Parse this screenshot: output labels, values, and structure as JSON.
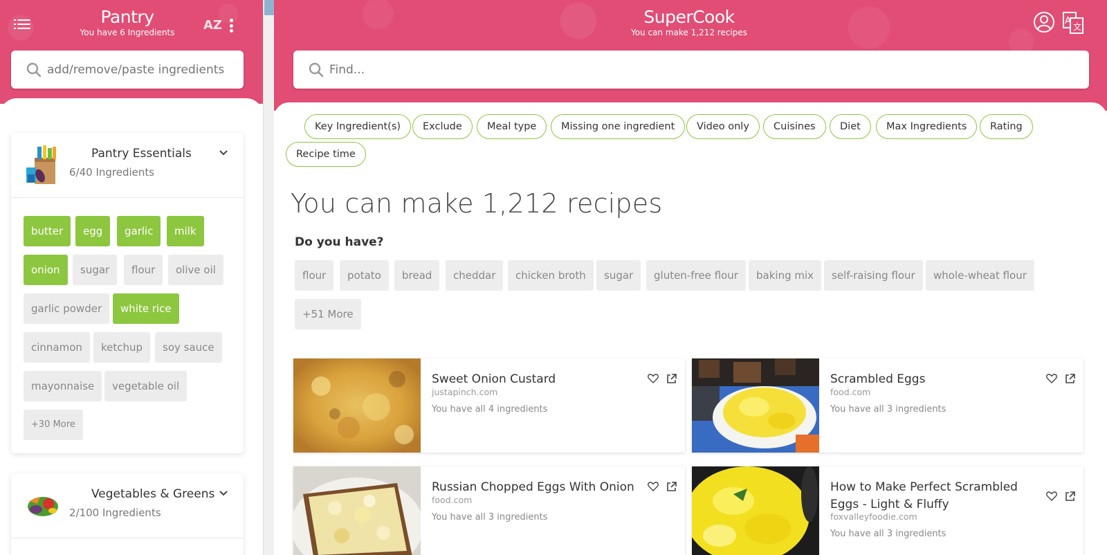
{
  "pantry": {
    "title": "Pantry",
    "subtitle": "You have 6 Ingredients",
    "sort_label": "AZ",
    "search_placeholder": "add/remove/paste ingredients",
    "categories": [
      {
        "title": "Pantry Essentials",
        "count": "6/40 Ingredients",
        "ingredients": [
          {
            "label": "butter",
            "selected": true
          },
          {
            "label": "egg",
            "selected": true
          },
          {
            "label": "garlic",
            "selected": true
          },
          {
            "label": "milk",
            "selected": true
          },
          {
            "label": "onion",
            "selected": true
          },
          {
            "label": "sugar",
            "selected": false
          },
          {
            "label": "flour",
            "selected": false
          },
          {
            "label": "olive oil",
            "selected": false
          },
          {
            "label": "garlic powder",
            "selected": false
          },
          {
            "label": "white rice",
            "selected": true
          },
          {
            "label": "cinnamon",
            "selected": false
          },
          {
            "label": "ketchup",
            "selected": false
          },
          {
            "label": "soy sauce",
            "selected": false
          },
          {
            "label": "mayonnaise",
            "selected": false
          },
          {
            "label": "vegetable oil",
            "selected": false
          }
        ],
        "more": "+30 More"
      },
      {
        "title": "Vegetables & Greens",
        "count": "2/100 Ingredients"
      }
    ]
  },
  "main": {
    "title": "SuperCook",
    "subtitle": "You can make 1,212 recipes",
    "search_placeholder": "Find...",
    "filters": [
      "Key Ingredient(s)",
      "Exclude",
      "Meal type",
      "Missing one ingredient",
      "Video only",
      "Cuisines",
      "Diet",
      "Max Ingredients",
      "Rating",
      "Recipe time"
    ],
    "heading": "You can make 1,212 recipes",
    "suggest_label": "Do you have?",
    "suggestions": [
      "flour",
      "potato",
      "bread",
      "cheddar",
      "chicken broth",
      "sugar",
      "gluten-free flour",
      "baking mix",
      "self-raising flour",
      "whole-wheat flour",
      "+51 More"
    ],
    "recipes": [
      {
        "title": "Sweet Onion Custard",
        "source": "justapinch.com",
        "have": "You have all 4 ingredients"
      },
      {
        "title": "Scrambled Eggs",
        "source": "food.com",
        "have": "You have all 3 ingredients"
      },
      {
        "title": "Russian Chopped Eggs With Onion",
        "source": "food.com",
        "have": "You have all 3 ingredients"
      },
      {
        "title": "How to Make Perfect Scrambled Eggs - Light & Fluffy",
        "source": "foxvalleyfoodie.com",
        "have": "You have all 3 ingredients"
      }
    ]
  },
  "colors": {
    "brand": "#e14d75",
    "accent_green": "#8dc63f",
    "chip_gray": "#ececec"
  },
  "icons": [
    "menu-icon",
    "sort-az-icon",
    "more-vert-icon",
    "search-icon",
    "chevron-down-icon",
    "user-icon",
    "translate-icon",
    "heart-icon",
    "external-link-icon"
  ]
}
